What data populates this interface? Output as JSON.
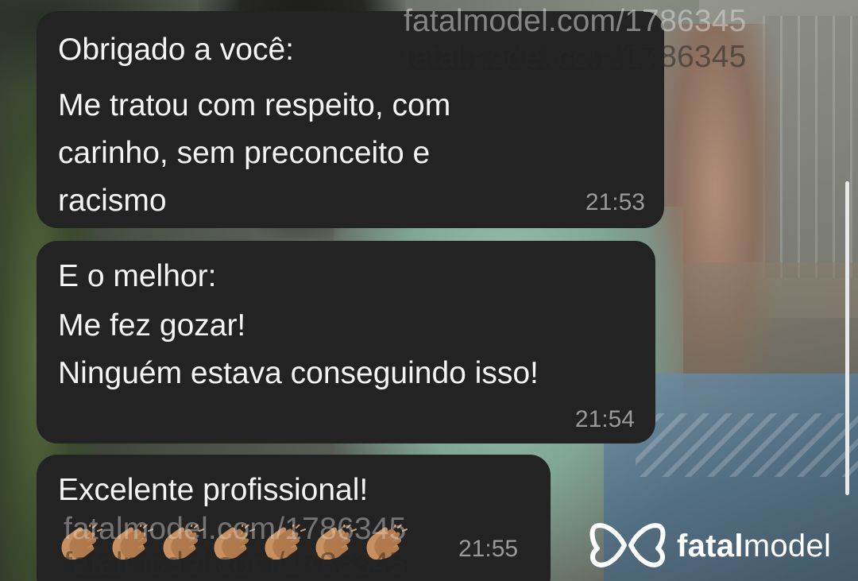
{
  "messages": [
    {
      "lines": [
        "Obrigado a você:",
        "Me tratou com respeito, com",
        "carinho, sem preconceito e",
        "racismo"
      ],
      "time": "21:53"
    },
    {
      "lines": [
        "E o melhor:",
        "Me fez gozar!",
        "Ninguém estava conseguindo isso!"
      ],
      "time": "21:54"
    },
    {
      "lines": [
        "Excelente profissional!"
      ],
      "emoji": "👏👏👏👏👏👏👏",
      "emoji_icon": "clapping-hands-icon",
      "time": "21:55"
    }
  ],
  "watermark": {
    "text": "fatalmodel.com/1786345"
  },
  "brand": {
    "name_bold": "fatal",
    "name_light": "model",
    "icon": "fatalmodel-butterfly-icon"
  },
  "colors": {
    "bubble_background": "#232323",
    "message_text": "#f4f4f4",
    "timestamp_text": "#9a9a9a",
    "scrollbar": "#e9e9e9"
  }
}
